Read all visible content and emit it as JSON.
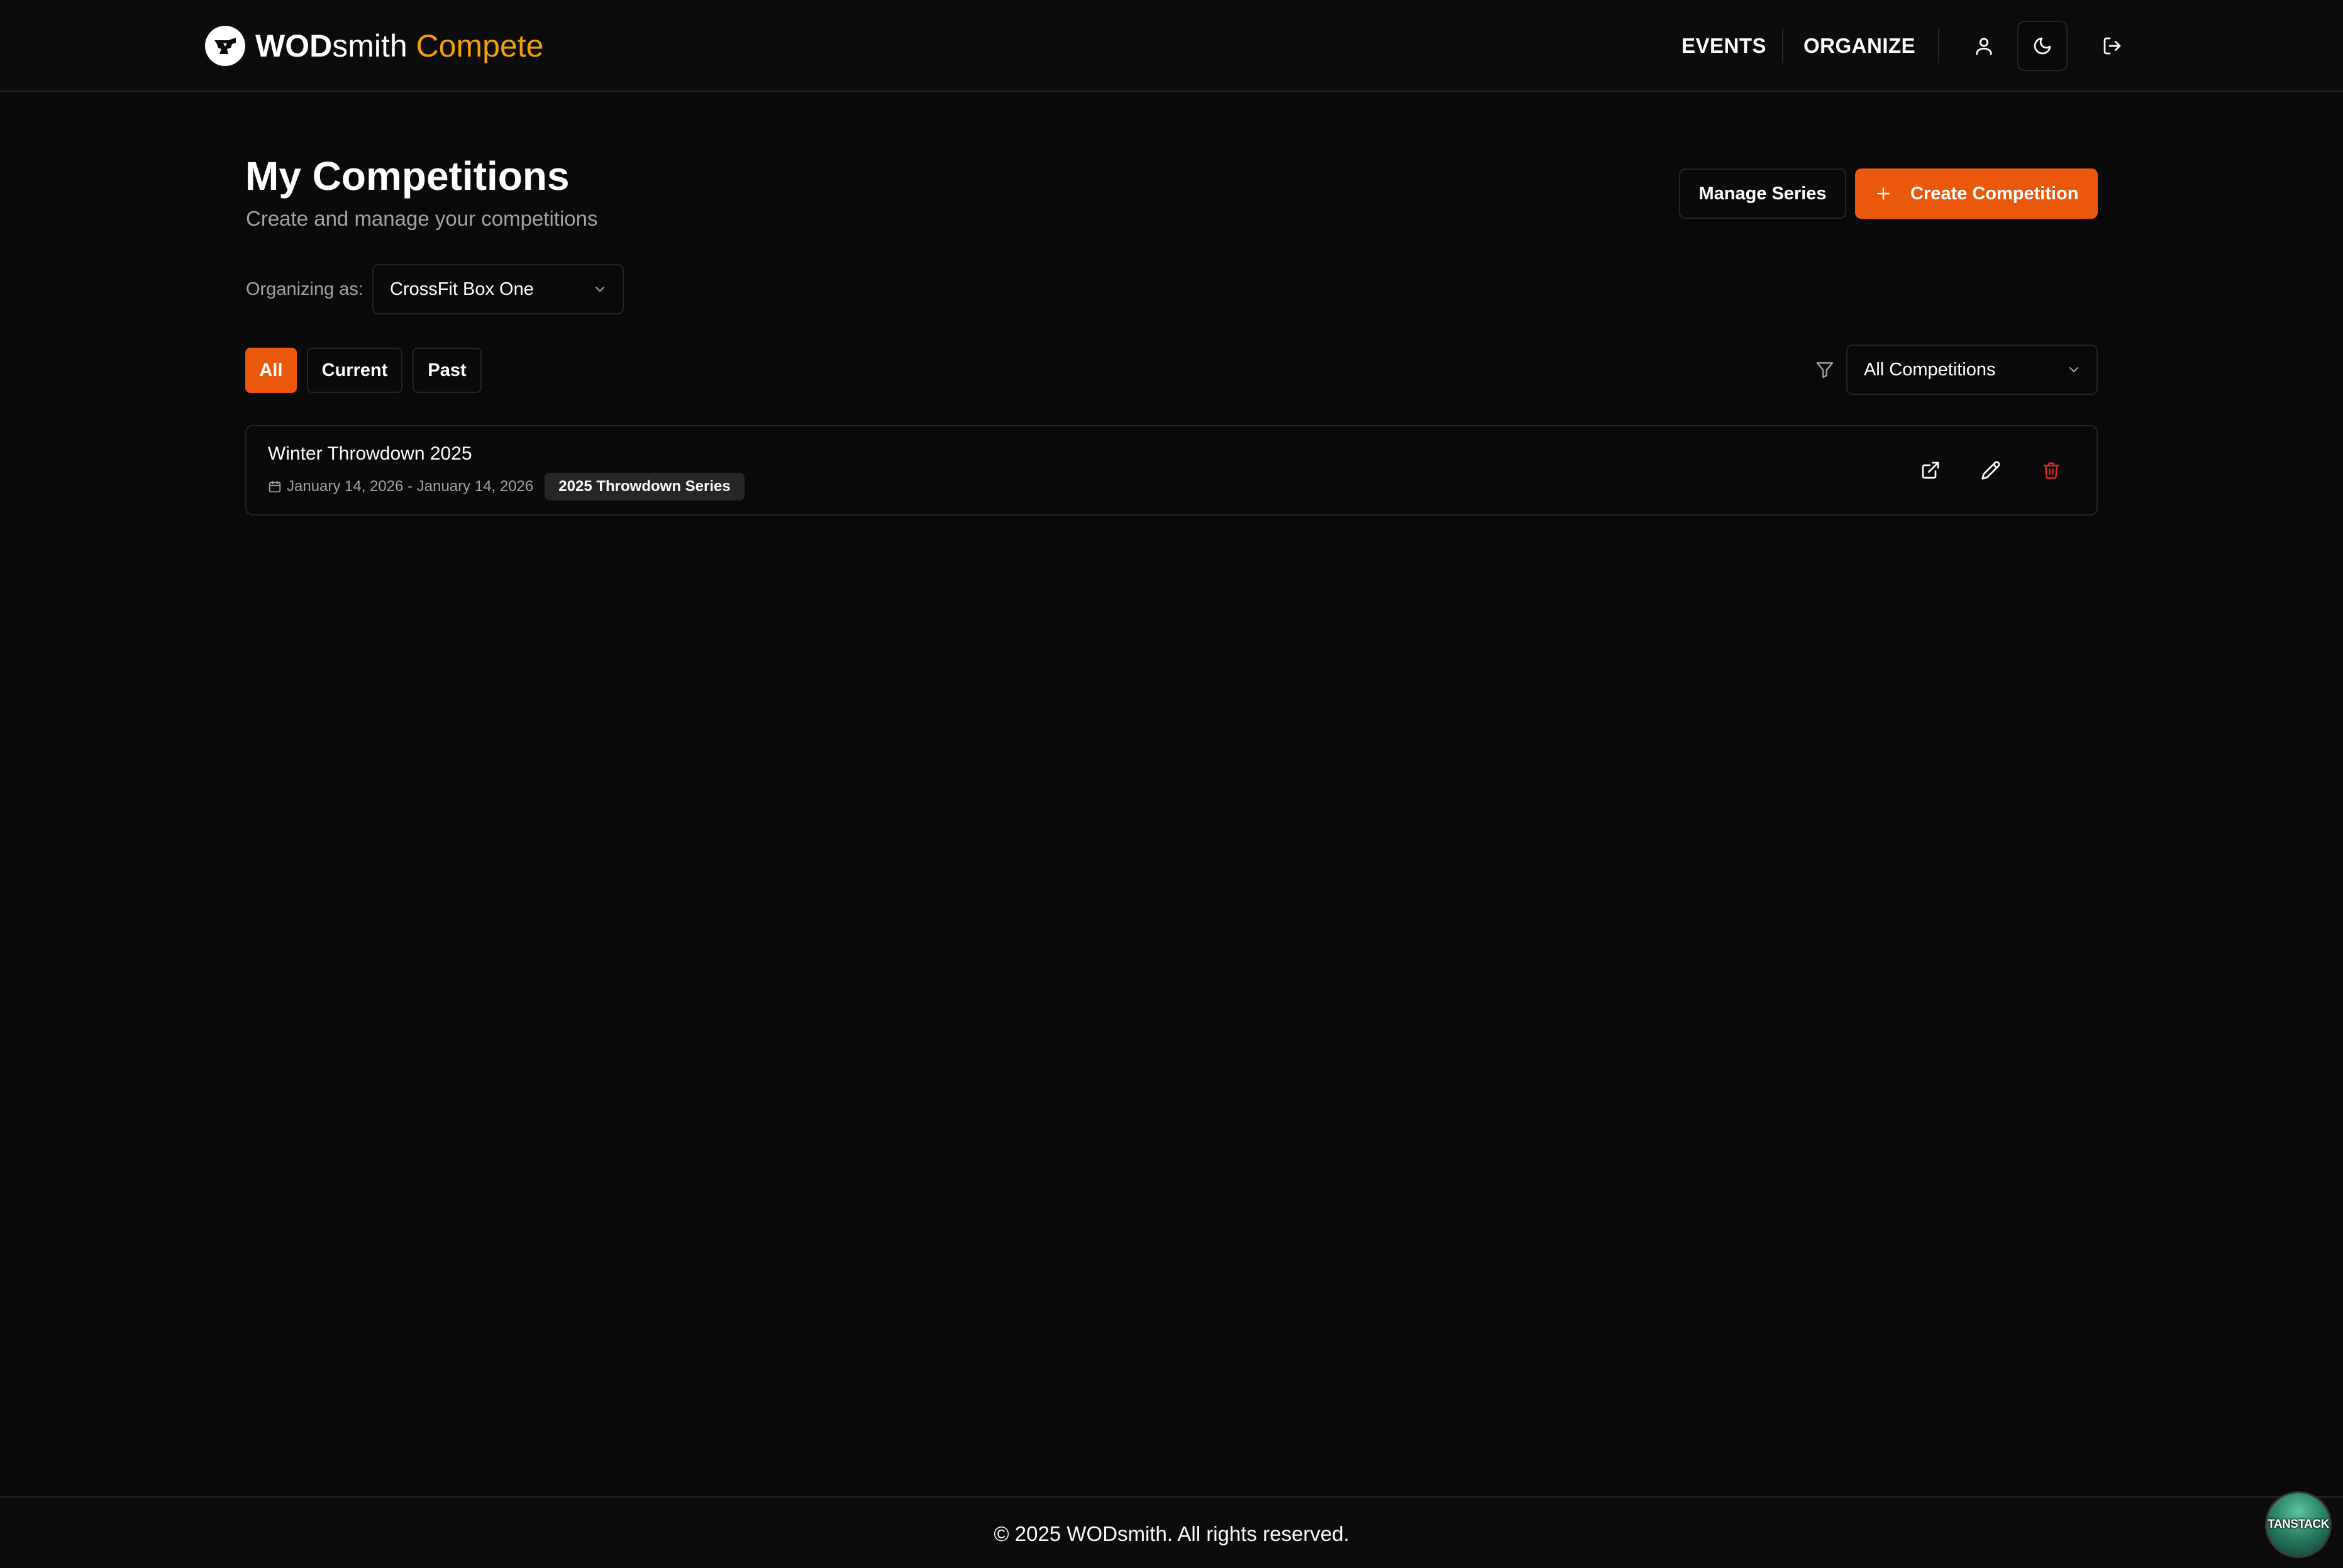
{
  "header": {
    "brand": {
      "bold": "WOD",
      "light": "smith",
      "accent": "Compete"
    },
    "nav": {
      "events": "EVENTS",
      "organize": "ORGANIZE"
    },
    "icons": {
      "profile": "user-icon",
      "theme": "moon-icon",
      "logout": "logout-icon"
    }
  },
  "main": {
    "title": "My Competitions",
    "subtitle": "Create and manage your competitions",
    "actions": {
      "manage_series": "Manage Series",
      "create_competition": "Create Competition"
    },
    "organizer": {
      "label": "Organizing as:",
      "selected": "CrossFit Box One"
    },
    "filters": {
      "tabs": [
        "All",
        "Current",
        "Past"
      ],
      "active": "All",
      "series_filter": "All Competitions"
    },
    "competitions": [
      {
        "name": "Winter Throwdown 2025",
        "dates": "January 14, 2026 - January 14, 2026",
        "series": "2025 Throwdown Series"
      }
    ]
  },
  "footer": {
    "copyright": "© 2025 WODsmith. All rights reserved.",
    "devtools_badge": "TANSTACK"
  },
  "colors": {
    "background": "#0a0a0a",
    "accent": "#ea580c",
    "brand_accent": "#f59e0b",
    "border": "#262626",
    "danger": "#dc2626"
  }
}
